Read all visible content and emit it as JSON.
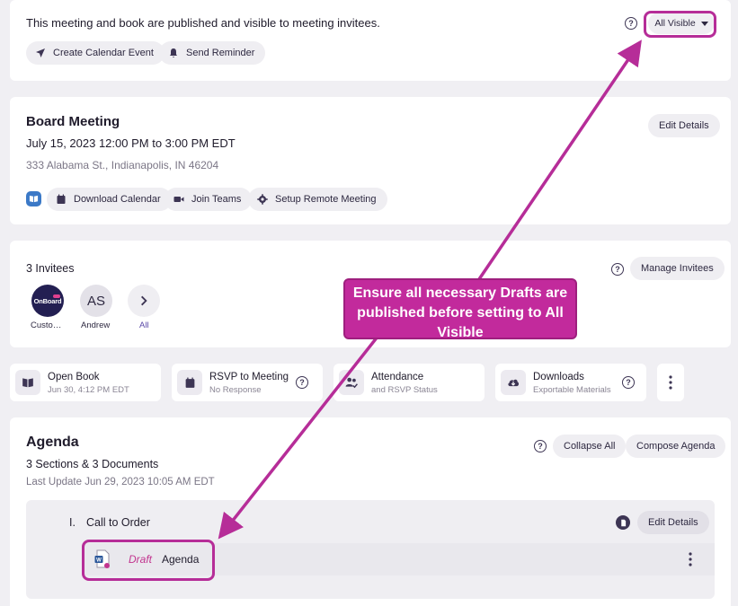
{
  "publish_bar": {
    "message": "This meeting and book are published and visible to meeting invitees.",
    "visibility_label": "All Visible",
    "create_event_label": "Create Calendar Event",
    "send_reminder_label": "Send Reminder"
  },
  "meeting": {
    "title": "Board Meeting",
    "datetime": "July 15, 2023 12:00 PM to 3:00 PM EDT",
    "location": "333 Alabama St., Indianapolis, IN 46204",
    "edit_label": "Edit Details",
    "download_calendar_label": "Download Calendar",
    "join_teams_label": "Join Teams",
    "setup_remote_label": "Setup Remote Meeting"
  },
  "invitees": {
    "count_label": "3 Invitees",
    "manage_label": "Manage Invitees",
    "people": [
      {
        "name": "Custo…",
        "initials": "OnBoard"
      },
      {
        "name": "Andrew",
        "initials": "AS"
      }
    ],
    "all_label": "All"
  },
  "tiles": [
    {
      "title": "Open Book",
      "subtitle": "Jun 30, 4:12 PM EDT"
    },
    {
      "title": "RSVP to Meeting",
      "subtitle": "No Response"
    },
    {
      "title": "Attendance",
      "subtitle": "and RSVP Status"
    },
    {
      "title": "Downloads",
      "subtitle": "Exportable Materials"
    }
  ],
  "agenda": {
    "title": "Agenda",
    "summary": "3 Sections & 3 Documents",
    "last_update": "Last Update Jun 29, 2023 10:05 AM EDT",
    "collapse_label": "Collapse All",
    "compose_label": "Compose Agenda",
    "section": {
      "number": "I.",
      "title": "Call to Order",
      "edit_label": "Edit Details",
      "document": {
        "status": "Draft",
        "name": "Agenda"
      }
    }
  },
  "annotation": {
    "callout": "Ensure all necessary Drafts are published before setting to All Visible"
  },
  "colors": {
    "accent": "#c22a9c",
    "draft": "#c2358f",
    "primary": "#3d3554",
    "link": "#5b4aa8"
  }
}
